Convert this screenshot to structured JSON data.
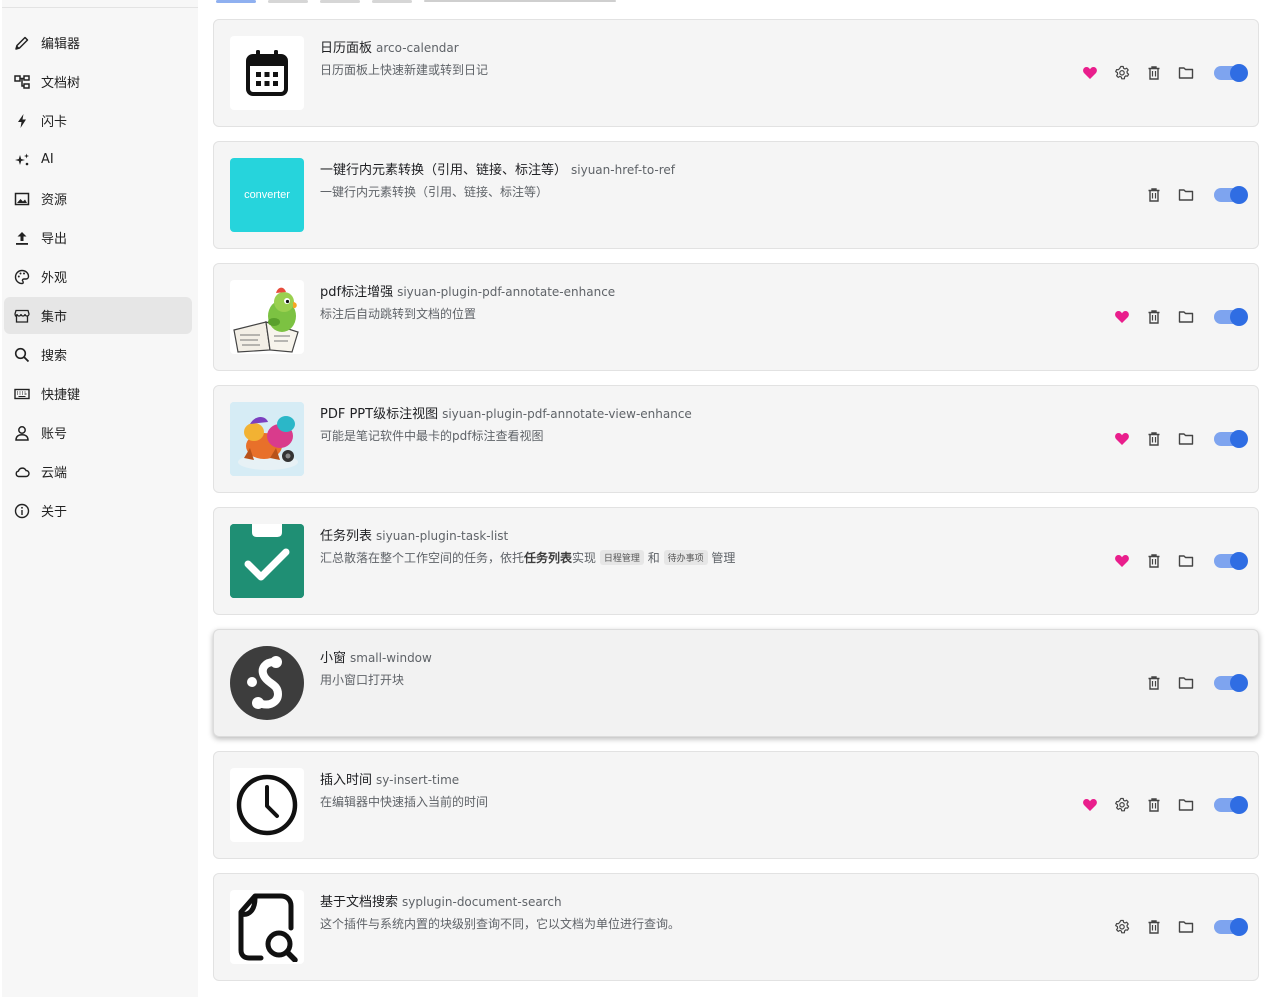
{
  "sidebar": {
    "items": [
      {
        "label": "编辑器",
        "icon": "pencil-icon",
        "active": false
      },
      {
        "label": "文档树",
        "icon": "file-tree-icon",
        "active": false
      },
      {
        "label": "闪卡",
        "icon": "lightning-icon",
        "active": false
      },
      {
        "label": "AI",
        "icon": "sparkle-icon",
        "active": false
      },
      {
        "label": "资源",
        "icon": "image-icon",
        "active": false
      },
      {
        "label": "导出",
        "icon": "upload-icon",
        "active": false
      },
      {
        "label": "外观",
        "icon": "palette-icon",
        "active": false
      },
      {
        "label": "集市",
        "icon": "store-icon",
        "active": true
      },
      {
        "label": "搜索",
        "icon": "search-icon",
        "active": false
      },
      {
        "label": "快捷键",
        "icon": "keyboard-icon",
        "active": false
      },
      {
        "label": "账号",
        "icon": "user-icon",
        "active": false
      },
      {
        "label": "云端",
        "icon": "cloud-icon",
        "active": false
      },
      {
        "label": "关于",
        "icon": "info-icon",
        "active": false
      }
    ]
  },
  "plugins": [
    {
      "name": "日历面板",
      "package": "arco-calendar",
      "desc": "日历面板上快速新建或转到日记",
      "icon": "calendar-icon",
      "fav": true,
      "settings": true,
      "enabled": true
    },
    {
      "name": "一键行内元素转换（引用、链接、标注等）",
      "package": "siyuan-href-to-ref",
      "desc": "一键行内元素转换（引用、链接、标注等）",
      "icon": "converter-icon",
      "thumb_text": "converter",
      "fav": false,
      "settings": false,
      "enabled": true
    },
    {
      "name": "pdf标注增强",
      "package": "siyuan-plugin-pdf-annotate-enhance",
      "desc": "标注后自动跳转到文档的位置",
      "icon": "parrot-reading-icon",
      "fav": true,
      "settings": false,
      "enabled": true
    },
    {
      "name": "PDF PPT级标注视图",
      "package": "siyuan-plugin-pdf-annotate-view-enhance",
      "desc": "可能是笔记软件中最卡的pdf标注查看视图",
      "icon": "colorful-animal-icon",
      "fav": true,
      "settings": false,
      "enabled": true
    },
    {
      "name": "任务列表",
      "package": "siyuan-plugin-task-list",
      "desc_parts": [
        "汇总散落在整个工作空间的任务，依托",
        "任务列表",
        "实现",
        "日程管理",
        "和",
        "待办事项",
        "管理"
      ],
      "icon": "task-check-icon",
      "fav": true,
      "settings": false,
      "enabled": true
    },
    {
      "name": "小窗",
      "package": "small-window",
      "desc": "用小窗口打开块",
      "icon": "small-window-logo-icon",
      "fav": false,
      "settings": false,
      "enabled": true
    },
    {
      "name": "插入时间",
      "package": "sy-insert-time",
      "desc": "在编辑器中快速插入当前的时间",
      "icon": "clock-icon",
      "fav": true,
      "settings": true,
      "enabled": true
    },
    {
      "name": "基于文档搜索",
      "package": "syplugin-document-search",
      "desc": "这个插件与系统内置的块级别查询不同，它以文档为单位进行查询。",
      "icon": "doc-search-icon",
      "fav": false,
      "settings": true,
      "enabled": true
    }
  ],
  "colors": {
    "accent": "#2f6de3",
    "heart": "#e91e8c",
    "teal": "#1f8f74",
    "converter": "#26d4dc"
  }
}
